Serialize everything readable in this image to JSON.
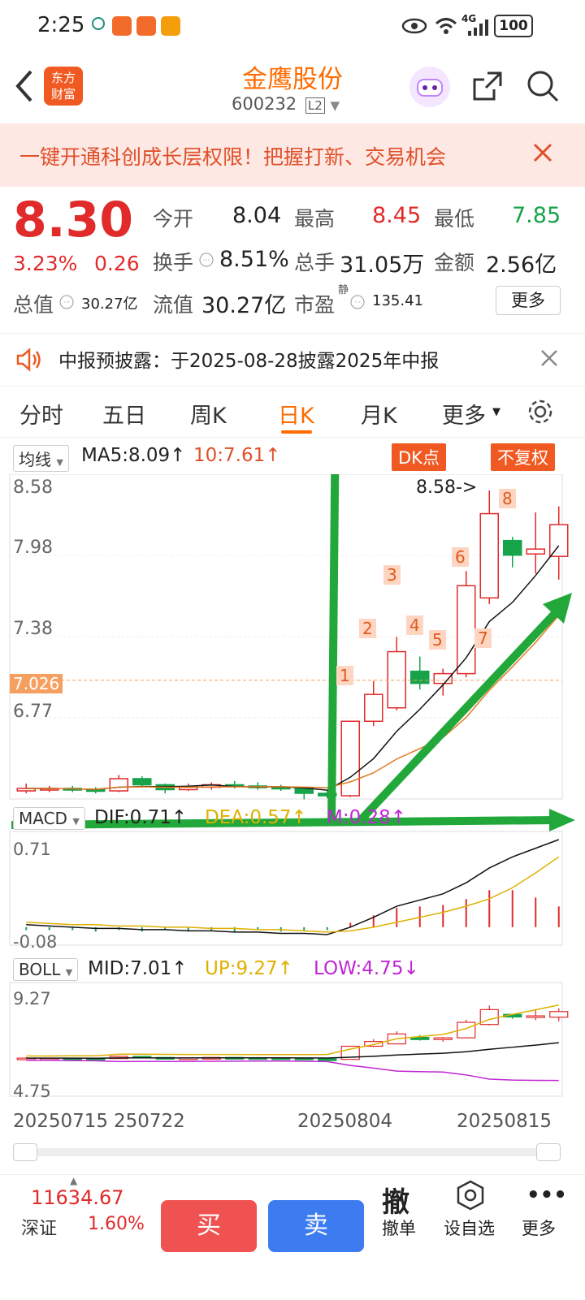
{
  "status_bar": {
    "time": "2:25",
    "battery": "100",
    "network": "4G"
  },
  "header": {
    "logo_text": "东方财富",
    "title": "金鹰股份",
    "code": "600232",
    "level": "L2"
  },
  "banner": {
    "text": "一键开通科创成长层权限！把握打新、交易机会"
  },
  "quote": {
    "price": "8.30",
    "change_pct": "3.23%",
    "change": "0.26",
    "open_label": "今开",
    "open": "8.04",
    "high_label": "最高",
    "high": "8.45",
    "low_label": "最低",
    "low": "7.85",
    "turnover_label": "换手",
    "turnover": "8.51%",
    "volume_label": "总手",
    "volume": "31.05万",
    "amount_label": "金额",
    "amount": "2.56亿",
    "mktcap_label": "总值",
    "mktcap": "30.27亿",
    "float_label": "流值",
    "float_cap": "30.27亿",
    "pe_label": "市盈",
    "pe_sup": "静",
    "pe": "135.41",
    "more": "更多"
  },
  "notice": {
    "text": "中报预披露：于2025-08-28披露2025年中报"
  },
  "tabs": [
    "分时",
    "五日",
    "周K",
    "日K",
    "月K",
    "更多"
  ],
  "active_tab": "日K",
  "chart_header": {
    "ma_select": "均线",
    "ma5": "MA5:8.09↑",
    "ma10": "10:7.61↑",
    "dk": "DK点",
    "fq": "不复权",
    "max_label": "8.58->"
  },
  "price_axis": [
    "8.58",
    "7.98",
    "7.38",
    "7.026",
    "6.77"
  ],
  "macd": {
    "select": "MACD",
    "dif": "DIF:0.71↑",
    "dea": "DEA:0.57↑",
    "m": "M:0.28↑",
    "top": "0.71",
    "bottom": "-0.08"
  },
  "boll": {
    "select": "BOLL",
    "mid": "MID:7.01↑",
    "up": "UP:9.27↑",
    "low": "LOW:4.75↓",
    "top": "9.27",
    "bottom": "4.75"
  },
  "dates": [
    "20250715",
    "250722",
    "20250804",
    "20250815"
  ],
  "signals": [
    "1",
    "2",
    "3",
    "4",
    "5",
    "6",
    "7",
    "8"
  ],
  "chart_data": {
    "type": "candlestick",
    "candles": [
      {
        "o": 6.12,
        "c": 6.14,
        "h": 6.18,
        "l": 6.1
      },
      {
        "o": 6.13,
        "c": 6.14,
        "h": 6.16,
        "l": 6.11
      },
      {
        "o": 6.14,
        "c": 6.13,
        "h": 6.16,
        "l": 6.11
      },
      {
        "o": 6.13,
        "c": 6.12,
        "h": 6.15,
        "l": 6.1
      },
      {
        "o": 6.12,
        "c": 6.22,
        "h": 6.25,
        "l": 6.11
      },
      {
        "o": 6.22,
        "c": 6.17,
        "h": 6.24,
        "l": 6.15
      },
      {
        "o": 6.17,
        "c": 6.13,
        "h": 6.18,
        "l": 6.1
      },
      {
        "o": 6.13,
        "c": 6.15,
        "h": 6.18,
        "l": 6.12
      },
      {
        "o": 6.15,
        "c": 6.17,
        "h": 6.19,
        "l": 6.13
      },
      {
        "o": 6.17,
        "c": 6.16,
        "h": 6.2,
        "l": 6.14
      },
      {
        "o": 6.16,
        "c": 6.15,
        "h": 6.19,
        "l": 6.13
      },
      {
        "o": 6.15,
        "c": 6.14,
        "h": 6.17,
        "l": 6.12
      },
      {
        "o": 6.14,
        "c": 6.1,
        "h": 6.15,
        "l": 6.05
      },
      {
        "o": 6.1,
        "c": 6.08,
        "h": 6.12,
        "l": 6.06
      },
      {
        "o": 6.08,
        "c": 6.69,
        "h": 6.69,
        "l": 6.07
      },
      {
        "o": 6.69,
        "c": 6.91,
        "h": 7.02,
        "l": 6.65
      },
      {
        "o": 6.8,
        "c": 7.26,
        "h": 7.38,
        "l": 6.78
      },
      {
        "o": 7.1,
        "c": 7.0,
        "h": 7.22,
        "l": 6.95
      },
      {
        "o": 7.0,
        "c": 7.08,
        "h": 7.12,
        "l": 6.9
      },
      {
        "o": 7.08,
        "c": 7.8,
        "h": 7.92,
        "l": 7.05
      },
      {
        "o": 7.7,
        "c": 8.39,
        "h": 8.58,
        "l": 7.65
      },
      {
        "o": 8.17,
        "c": 8.05,
        "h": 8.2,
        "l": 7.95
      },
      {
        "o": 8.06,
        "c": 8.1,
        "h": 8.4,
        "l": 7.9
      },
      {
        "o": 8.04,
        "c": 8.3,
        "h": 8.45,
        "l": 7.85
      }
    ],
    "ylim": [
      6.12,
      8.58
    ],
    "macd_dif": [
      0.02,
      0.01,
      0.0,
      -0.01,
      -0.01,
      -0.02,
      -0.02,
      -0.03,
      -0.03,
      -0.04,
      -0.04,
      -0.05,
      -0.05,
      -0.06,
      0.0,
      0.08,
      0.17,
      0.22,
      0.27,
      0.36,
      0.48,
      0.57,
      0.64,
      0.71
    ],
    "macd_dea": [
      0.04,
      0.03,
      0.02,
      0.02,
      0.01,
      0.01,
      0.0,
      0.0,
      -0.01,
      -0.01,
      -0.02,
      -0.02,
      -0.03,
      -0.04,
      -0.03,
      0.0,
      0.04,
      0.08,
      0.12,
      0.17,
      0.23,
      0.32,
      0.44,
      0.57
    ]
  },
  "bottom": {
    "index_value": "11634.67",
    "index_name": "深证",
    "index_change": "1.60%",
    "buy": "买",
    "sell": "卖",
    "cancel_icon": "撤",
    "cancel": "撤单",
    "watch": "设自选",
    "more": "更多"
  },
  "colors": {
    "up": "#e12a2a",
    "down": "#16a34a",
    "accent": "#ff6b00",
    "annotation_arrow": "#22a83a"
  }
}
